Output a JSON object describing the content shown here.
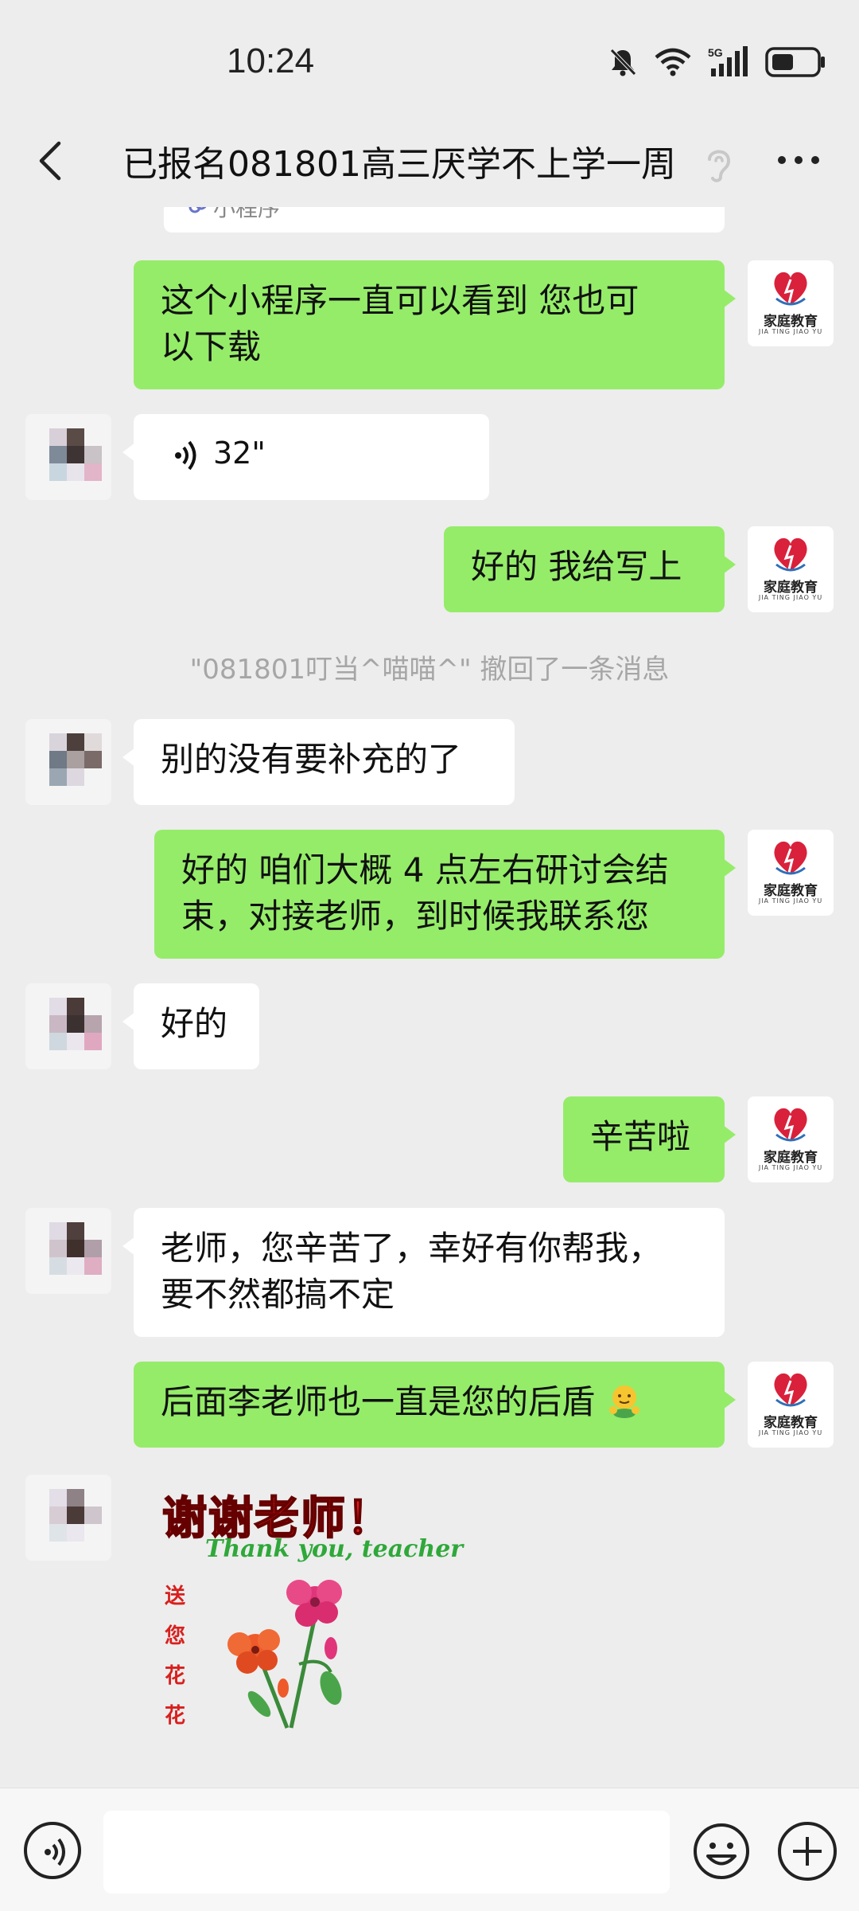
{
  "status_bar": {
    "time": "10:24",
    "icons": [
      "mute-bell-icon",
      "wifi-icon",
      "5g-signal-icon",
      "battery-icon"
    ],
    "network_label": "5G"
  },
  "nav": {
    "back_icon": "chevron-left-icon",
    "title": "已报名081801高三厌学不上学一周",
    "ear_icon": "ear-icon",
    "more_icon": "more-dots-icon"
  },
  "chat": {
    "mini_program_label": "小程序",
    "messages": [
      {
        "side": "right",
        "type": "text",
        "lines": [
          "这个小程序一直可以看到 您也可",
          "以下载"
        ]
      },
      {
        "side": "left",
        "type": "voice",
        "duration": "32\""
      },
      {
        "side": "right",
        "type": "text",
        "lines": [
          "好的 我给写上"
        ]
      },
      {
        "side": "system",
        "type": "recall",
        "text": "\"081801叮当^喵喵^\" 撤回了一条消息"
      },
      {
        "side": "left",
        "type": "text",
        "lines": [
          "别的没有要补充的了"
        ]
      },
      {
        "side": "right",
        "type": "text",
        "lines": [
          "好的 咱们大概 4 点左右研讨会结",
          "束，对接老师，到时候我联系您"
        ]
      },
      {
        "side": "left",
        "type": "text",
        "lines": [
          "好的"
        ]
      },
      {
        "side": "right",
        "type": "text",
        "lines": [
          "辛苦啦"
        ]
      },
      {
        "side": "left",
        "type": "text",
        "lines": [
          "老师，您辛苦了，幸好有你帮我，",
          "要不然都搞不定"
        ]
      },
      {
        "side": "right",
        "type": "text",
        "lines": [
          "后面李老师也一直是您的后盾"
        ],
        "emoji": "hug-emoji-icon"
      },
      {
        "side": "left",
        "type": "sticker"
      }
    ],
    "self_avatar": {
      "logo_text": "家庭教育",
      "logo_sub": "JIA TING JIAO YU",
      "colors": {
        "red": "#d9213b",
        "blue": "#2f6fb8"
      }
    },
    "sticker": {
      "title": "谢谢老师！",
      "subtitle": "Thank you, teacher",
      "side_text": [
        "送",
        "您",
        "花",
        "花"
      ]
    }
  },
  "colors": {
    "background": "#ededed",
    "bubble_self": "#95ec69",
    "bubble_other": "#ffffff",
    "system_text": "#a6a6a6"
  },
  "input_bar": {
    "voice_icon": "voice-mode-icon",
    "emoji_icon": "emoji-icon",
    "plus_icon": "plus-icon",
    "value": ""
  }
}
